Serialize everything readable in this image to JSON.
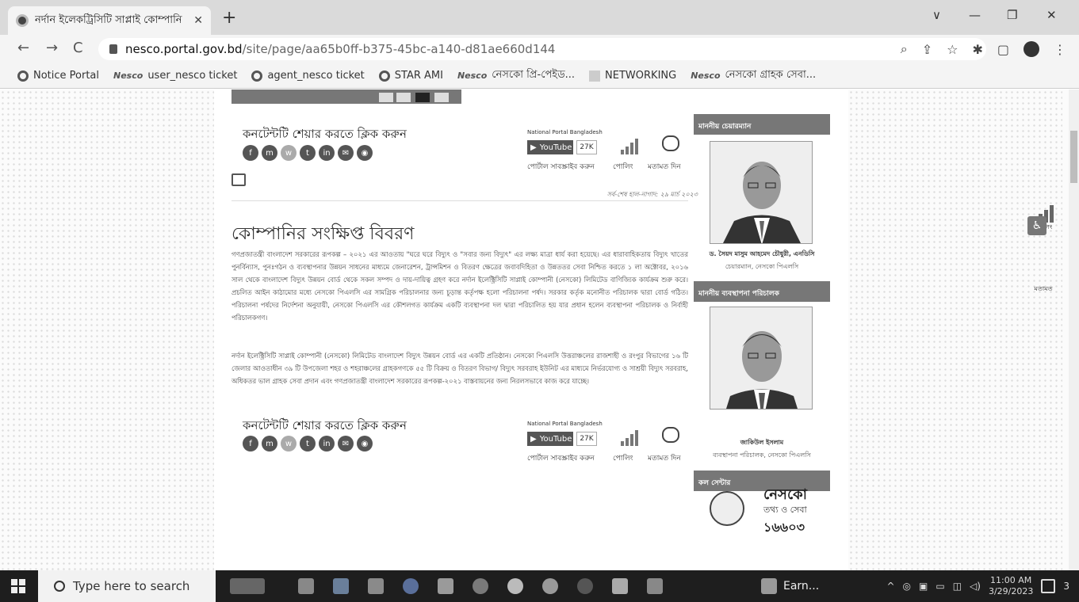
{
  "browser": {
    "tab_title": "নর্দান ইলেকট্রিসিটি সাপ্লাই কোম্পানি",
    "tab_close": "✕",
    "new_tab": "+",
    "window": {
      "menu": "∨",
      "minimize": "—",
      "restore": "❐",
      "close": "✕"
    },
    "url_host": "nesco.portal.gov.bd",
    "url_path": "/site/page/aa65b0ff-b375-45bc-a140-d81ae660d144",
    "nav": {
      "back": "←",
      "forward": "→",
      "reload": "C"
    },
    "toolbar_icons": [
      "zoom-icon",
      "share-icon",
      "star-icon",
      "extensions-icon",
      "sidebar-icon",
      "profile-icon",
      "menu-icon"
    ],
    "bookmarks": [
      {
        "label": "Notice Portal",
        "icon": "circle"
      },
      {
        "label": "user_nesco ticket",
        "icon": "nesco"
      },
      {
        "label": "agent_nesco ticket",
        "icon": "circle"
      },
      {
        "label": "STAR AMI",
        "icon": "circle"
      },
      {
        "label": "নেসকো প্রি-পেইড...",
        "icon": "nesco"
      },
      {
        "label": "NETWORKING",
        "icon": "square"
      },
      {
        "label": "নেসকো গ্রাহক সেবা...",
        "icon": "nesco"
      }
    ],
    "nesco_mark": "Nesco"
  },
  "page": {
    "share_title": "কনটেন্টটি শেয়ার করতে ক্লিক করুন",
    "social_icons": [
      "f",
      "m",
      "w",
      "t",
      "in",
      "✉",
      "◉"
    ],
    "widget": {
      "national_portal": "National Portal Bangladesh",
      "youtube": "YouTube",
      "youtube_count": "27K",
      "subscribe": "পোর্টাল সাবস্ক্রাইব করুন",
      "polling": "পোলিং",
      "feedback": "মতামত দিন"
    },
    "last_updated": "সর্ব-শেষ হাল-নাগাদ: ২৯ মার্চ ২০২৩",
    "heading": "কোম্পানির সংক্ষিপ্ত বিবরণ",
    "paragraph1": "গণপ্রজাতন্ত্রী বাংলাদেশ সরকারের রূপকল্প – ২০২১ এর আওতায় \"ঘরে ঘরে বিদ্যুৎ ও \"সবার জন্য বিদ্যুৎ\" এর লক্ষ্য মাত্রা ধার্য করা হয়েছে। এর ধারাবাহিকতায় বিদ্যুৎ খাতের পুনর্বিন্যাস, পুনঃগঠন ও ব্যবস্থাপনার উন্নয়ন সাধনের মাধ্যমে জেনারেশন, ট্রান্সমিশন ও বিতরণ ক্ষেত্রের জবাবদিহিতা ও উন্নততর সেবা নিশ্চিত করতে ১ লা অক্টোবর, ২০১৬ সাল থেকে বাংলাদেশ বিদ্যুৎ উন্নয়ন বোর্ড থেকে সকল সম্পদ ও দায়-দায়িত্ব গ্রহণ করে নর্দান ইলেক্ট্রিসিটি সাপ্লাই কোম্পানী (নেসকো) লিমিটেড বাণিজ্যিক কার্যক্রম শুরু করে। প্রচলিত আইন কাঠামোর মধ্যে নেসকো পিএলসি এর সামগ্রিক পরিচালনার জন্য চূড়ান্ত কর্তৃপক্ষ হলো পরিচালনা পর্ষদ। সরকার কর্তৃক মনোনীত পরিচালক দ্বারা বোর্ড গঠিত। পরিচালনা পর্ষদের নির্দেশনা অনুযায়ী, নেসকো পিএলসি এর কৌশলগত কার্যক্রম একটি ব্যবস্থাপনা দল দ্বারা পরিচালিত হয় যার প্রধান হলেন ব্যবস্থাপনা পরিচালক ও নির্বাহী পরিচালকগণ।",
    "paragraph2": "নর্দান ইলেক্ট্রিসিটি সাপ্লাই কোম্পানী (নেসকো) লিমিটেড বাংলাদেশ বিদ্যুৎ উন্নয়ন বোর্ড এর একটি প্রতিষ্ঠান। নেসকো পিএলসি উত্তরাঞ্চলের রাজশাহী ও রংপুর বিভাগের ১৬ টি জেলার আওতাধীন ৩৯ টি উপজেলা শহর ও শহরাঞ্চলের গ্রাহকগণকে ৫৫ টি বিক্রয় ও বিতরণ বিভাগ/ বিদ্যুৎ সরবরাহ ইউনিট এর মাধ্যমে নির্ভরযোগ্য ও সাশ্রয়ী বিদ্যুৎ সরবরাহ, অধিকতর ভাল গ্রাহক সেবা প্রদান এবং গণপ্রজাতন্ত্রী বাংলাদেশ সরকারের রূপকল্প-২০২১ বাস্তবায়নের জন্য নিরলসভাবে কাজ করে যাচ্ছে।"
  },
  "sidebar": {
    "chairman_head": "মাননীয় চেয়ারম্যান",
    "chairman_name": "ড. সৈয়দ মাসুম আহমেদ চৌধুরী, এনডিসি",
    "chairman_title": "চেয়ারম্যান, নেসকো পিএলসি",
    "md_head": "মাননীয় ব্যবস্থাপনা পরিচালক",
    "md_name": "জাকিউল ইসলাম",
    "md_title": "ব্যবস্থাপনা পরিচালক, নেসকো পিএলসি",
    "call_head": "কল সেন্টার",
    "call_brand": "নেসকো",
    "call_sub": "তথ্য ও সেবা",
    "call_number": "১৬৬০৩"
  },
  "floating": {
    "polling": "পোলিং",
    "feedback": "মতামত",
    "accessibility_icon": "accessibility-icon"
  },
  "taskbar": {
    "search_placeholder": "Type here to search",
    "earn_label": "Earn...",
    "time": "11:00 AM",
    "date": "3/29/2023",
    "notifications": "3",
    "tray_chevron": "^"
  }
}
